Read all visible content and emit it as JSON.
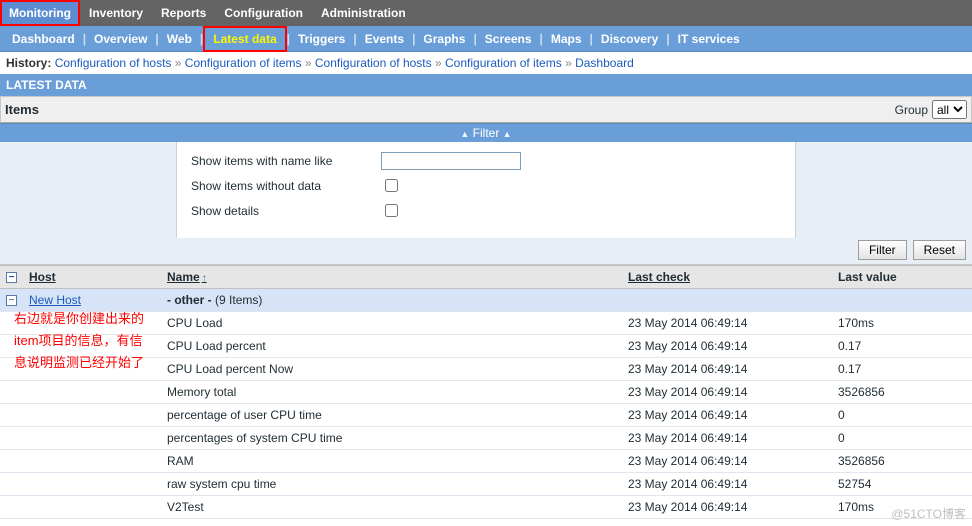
{
  "topnav": {
    "items": [
      "Monitoring",
      "Inventory",
      "Reports",
      "Configuration",
      "Administration"
    ],
    "active_index": 0
  },
  "subnav": {
    "items": [
      "Dashboard",
      "Overview",
      "Web",
      "Latest data",
      "Triggers",
      "Events",
      "Graphs",
      "Screens",
      "Maps",
      "Discovery",
      "IT services"
    ],
    "current_index": 3
  },
  "history": {
    "label": "History:",
    "items": [
      "Configuration of hosts",
      "Configuration of items",
      "Configuration of hosts",
      "Configuration of items",
      "Dashboard"
    ]
  },
  "page_header": "LATEST DATA",
  "items_bar": {
    "title": "Items",
    "group_label": "Group",
    "group_value": "all"
  },
  "filter": {
    "caption": "Filter",
    "name_like_label": "Show items with name like",
    "without_data_label": "Show items without data",
    "show_details_label": "Show details",
    "name_like_value": "",
    "filter_btn": "Filter",
    "reset_btn": "Reset"
  },
  "table": {
    "headers": {
      "host": "Host",
      "name": "Name",
      "last_check": "Last check",
      "last_value": "Last value"
    },
    "host_link": "New Host",
    "group_row": {
      "name": "- other -",
      "count_text": "(9 Items)"
    },
    "rows": [
      {
        "name": "CPU Load",
        "last_check": "23 May 2014 06:49:14",
        "last_value": "170ms"
      },
      {
        "name": "CPU Load percent",
        "last_check": "23 May 2014 06:49:14",
        "last_value": "0.17"
      },
      {
        "name": "CPU Load percent Now",
        "last_check": "23 May 2014 06:49:14",
        "last_value": "0.17"
      },
      {
        "name": "Memory total",
        "last_check": "23 May 2014 06:49:14",
        "last_value": "3526856"
      },
      {
        "name": "percentage of user CPU time",
        "last_check": "23 May 2014 06:49:14",
        "last_value": "0"
      },
      {
        "name": "percentages of system CPU time",
        "last_check": "23 May 2014 06:49:14",
        "last_value": "0"
      },
      {
        "name": "RAM",
        "last_check": "23 May 2014 06:49:14",
        "last_value": "3526856"
      },
      {
        "name": "raw system cpu time",
        "last_check": "23 May 2014 06:49:14",
        "last_value": "52754"
      },
      {
        "name": "V2Test",
        "last_check": "23 May 2014 06:49:14",
        "last_value": "170ms"
      }
    ]
  },
  "annotation": "右边就是你创建出来的item项目的信息，有信息说明监测已经开始了",
  "watermark": "@51CTO博客"
}
